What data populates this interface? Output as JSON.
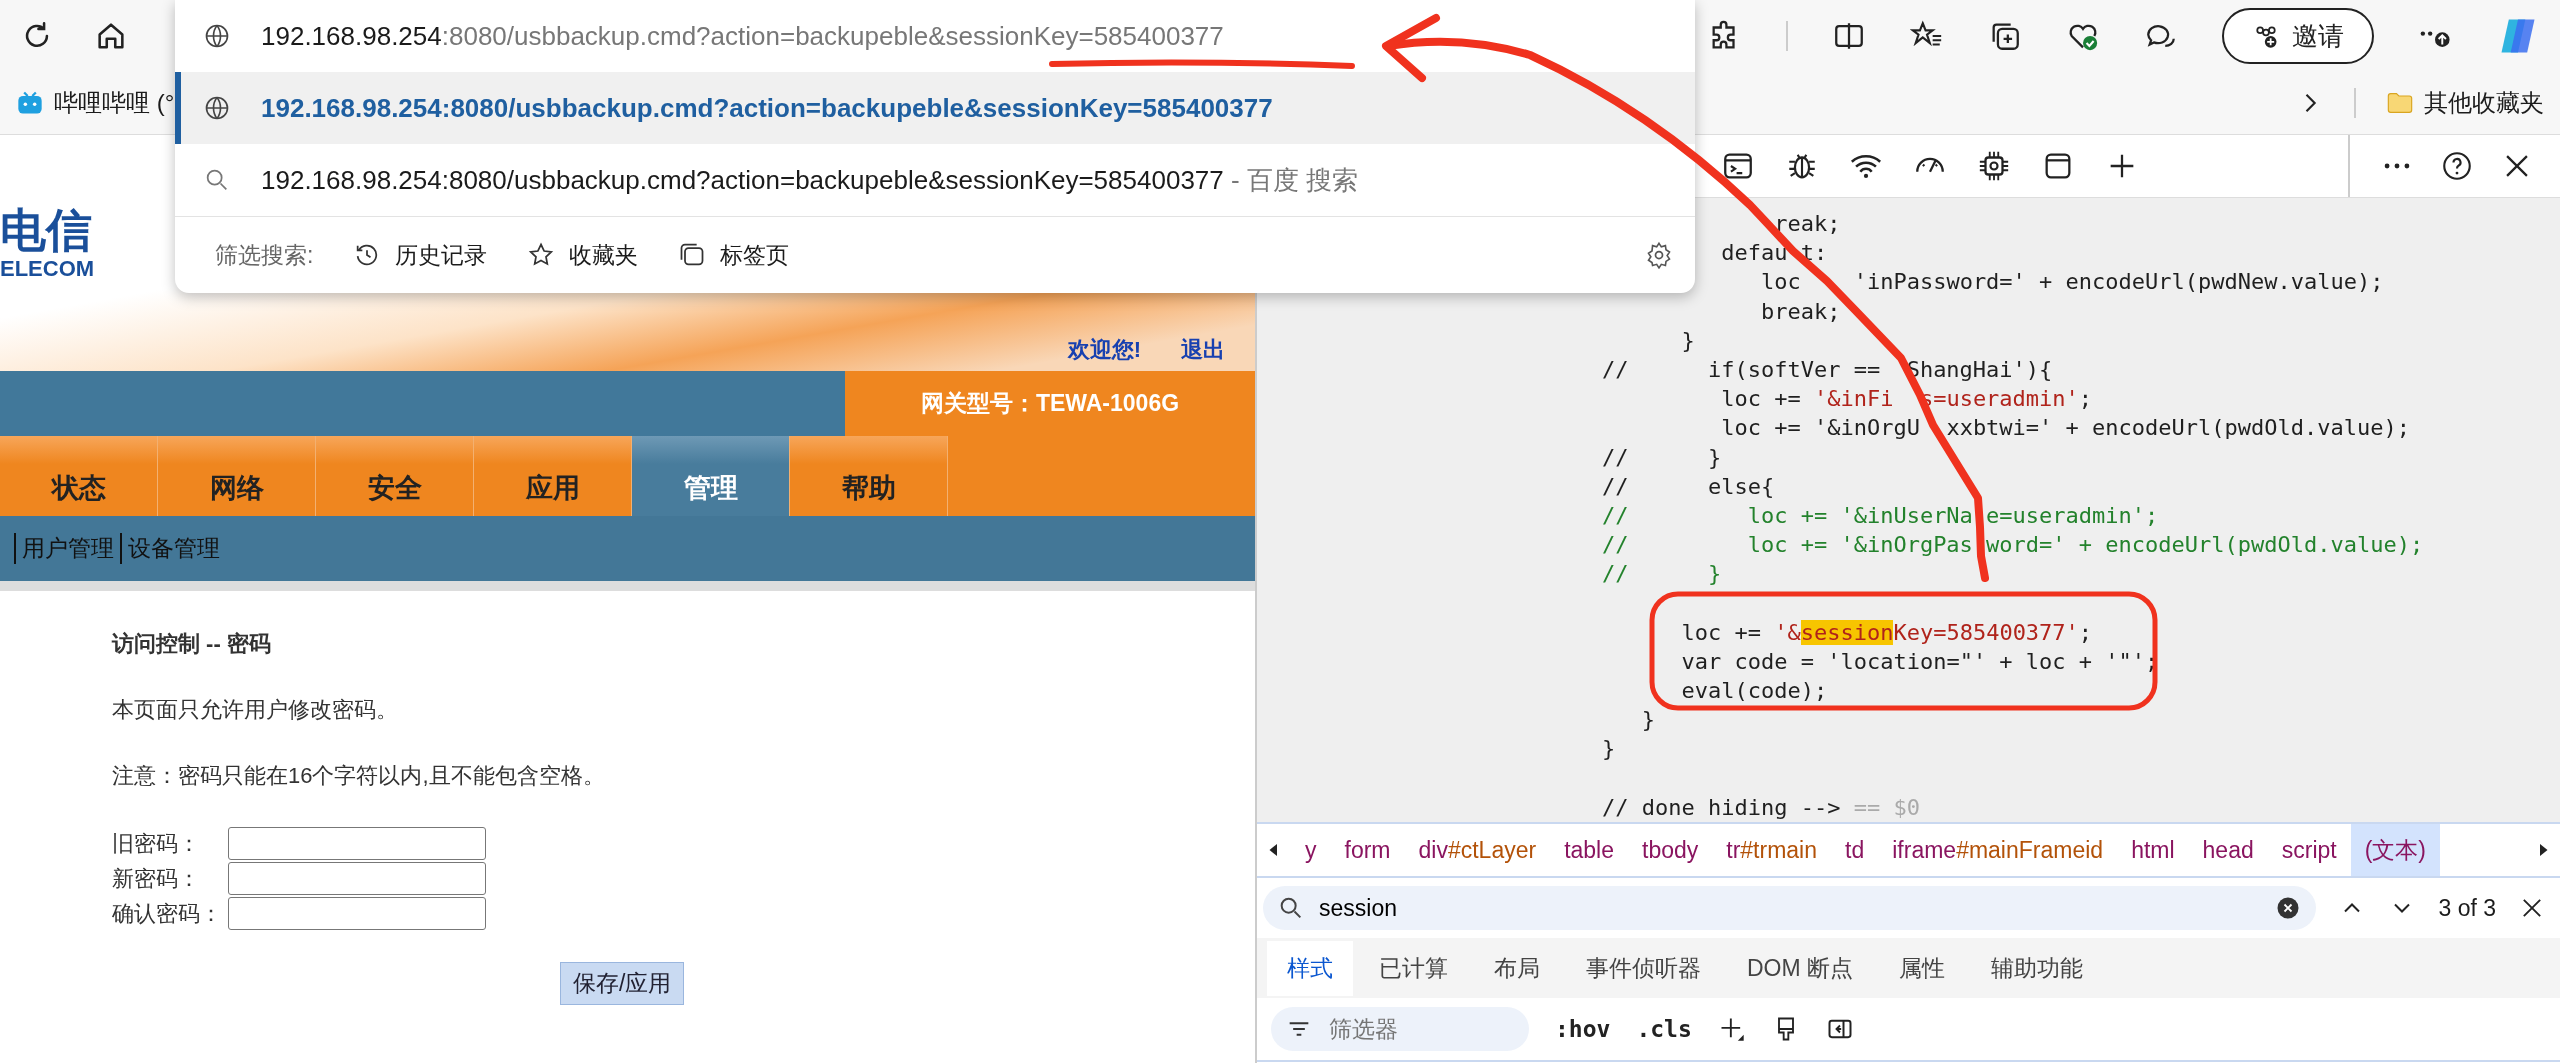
{
  "browser_toolbar": {
    "invite_button": "邀请"
  },
  "bookmarks_bar": {
    "items": [
      {
        "label": "哔哩哔哩 (°"
      }
    ],
    "other_favorites": "其他收藏夹"
  },
  "address_dropdown": {
    "input": {
      "host": "192.168.98.254",
      "rest": ":8080/usbbackup.cmd?action=backupeble&sessionKey=585400377"
    },
    "suggestions": [
      {
        "kind": "url",
        "text": "192.168.98.254:8080/usbbackup.cmd?action=backupeble&sessionKey=585400377",
        "selected": true
      },
      {
        "kind": "search",
        "text": "192.168.98.254:8080/usbbackup.cmd?action=backupeble&sessionKey=585400377",
        "suffix": " - 百度 搜索",
        "selected": false
      }
    ],
    "filter_label": "筛选搜索:",
    "filters": [
      {
        "kind": "history",
        "label": "历史记录"
      },
      {
        "kind": "favorites",
        "label": "收藏夹"
      },
      {
        "kind": "tabs",
        "label": "标签页"
      }
    ]
  },
  "router_page": {
    "logo": {
      "mark": "电信",
      "word": "ELECOM"
    },
    "welcome_link": "欢迎您!",
    "logout_link": "退出",
    "model_label": "网关型号：TEWA-1006G",
    "tabs": [
      {
        "label": "状态",
        "selected": false
      },
      {
        "label": "网络",
        "selected": false
      },
      {
        "label": "安全",
        "selected": false
      },
      {
        "label": "应用",
        "selected": false
      },
      {
        "label": "管理",
        "selected": true
      },
      {
        "label": "帮助",
        "selected": false
      }
    ],
    "subnav": [
      "用户管理",
      "设备管理"
    ],
    "heading": "访问控制 -- 密码",
    "intro": "本页面只允许用户修改密码。",
    "note": "注意：密码只能在16个字符以内,且不能包含空格。",
    "fields": [
      {
        "label": "旧密码："
      },
      {
        "label": "新密码："
      },
      {
        "label": "确认密码："
      }
    ],
    "save_button": "保存/应用"
  },
  "devtools": {
    "code_lines": [
      [
        {
          "kind": "code",
          "text": "             reak;"
        }
      ],
      [
        {
          "kind": "code",
          "text": "         defau t:"
        }
      ],
      [
        {
          "kind": "code",
          "text": "            loc    'inPassword=' + encodeUrl(pwdNew.value);"
        }
      ],
      [
        {
          "kind": "code",
          "text": "            break;"
        }
      ],
      [
        {
          "kind": "code",
          "text": "      }"
        }
      ],
      [
        {
          "kind": "code",
          "text": "//      if(softVer ==  ShangHai'){"
        }
      ],
      [
        {
          "kind": "code",
          "text": "         loc += "
        },
        {
          "kind": "string",
          "text": "'&inFi  s=useradmin'"
        },
        {
          "kind": "code",
          "text": ";"
        }
      ],
      [
        {
          "kind": "code",
          "text": "         loc += '&inOrgU  xxbtwi=' + encodeUrl(pwdOld.value);"
        }
      ],
      [
        {
          "kind": "code",
          "text": "//      }"
        }
      ],
      [
        {
          "kind": "code",
          "text": "//      else{"
        }
      ],
      [
        {
          "kind": "comment",
          "text": "//         loc += '&inUserNa e=useradmin';"
        }
      ],
      [
        {
          "kind": "comment",
          "text": "//         loc += '&inOrgPas word=' + encodeUrl(pwdOld.value);"
        }
      ],
      [
        {
          "kind": "comment",
          "text": "//      }"
        }
      ],
      [
        {
          "kind": "blank"
        }
      ],
      [
        {
          "kind": "code",
          "text": "      loc += "
        },
        {
          "kind": "string",
          "text": "'&"
        },
        {
          "kind": "match",
          "text": "session"
        },
        {
          "kind": "string",
          "text": "Key=585400377'"
        },
        {
          "kind": "code",
          "text": ";"
        }
      ],
      [
        {
          "kind": "code",
          "text": "      var code = 'location=\"' + loc + '\"';"
        }
      ],
      [
        {
          "kind": "code",
          "text": "      eval(code);"
        }
      ],
      [
        {
          "kind": "code",
          "text": "   }"
        }
      ],
      [
        {
          "kind": "code",
          "text": "}"
        }
      ],
      [
        {
          "kind": "blank"
        }
      ],
      [
        {
          "kind": "code",
          "text": "// done hiding -->"
        },
        {
          "kind": "faint",
          "text": " == $0"
        }
      ]
    ],
    "breadcrumb": [
      {
        "tag": "y",
        "selected": false
      },
      {
        "tag": "form",
        "selected": false
      },
      {
        "tag": "div",
        "id": "#ctLayer",
        "selected": false
      },
      {
        "tag": "table",
        "selected": false
      },
      {
        "tag": "tbody",
        "selected": false
      },
      {
        "tag": "tr",
        "id": "#trmain",
        "selected": false
      },
      {
        "tag": "td",
        "selected": false
      },
      {
        "tag": "iframe",
        "id": "#mainFrameid",
        "selected": false
      },
      {
        "tag": "html",
        "selected": false
      },
      {
        "tag": "head",
        "selected": false
      },
      {
        "tag": "script",
        "selected": false
      },
      {
        "tag": "(文本)",
        "selected": true
      }
    ],
    "search": {
      "value": "session",
      "count": "3 of 3"
    },
    "panel_tabs": [
      {
        "label": "样式",
        "selected": true
      },
      {
        "label": "已计算",
        "selected": false
      },
      {
        "label": "布局",
        "selected": false
      },
      {
        "label": "事件侦听器",
        "selected": false
      },
      {
        "label": "DOM 断点",
        "selected": false
      },
      {
        "label": "属性",
        "selected": false
      },
      {
        "label": "辅助功能",
        "selected": false
      }
    ],
    "filter": {
      "placeholder": "筛选器"
    },
    "style_buttons": [
      ":hov",
      ".cls"
    ]
  }
}
